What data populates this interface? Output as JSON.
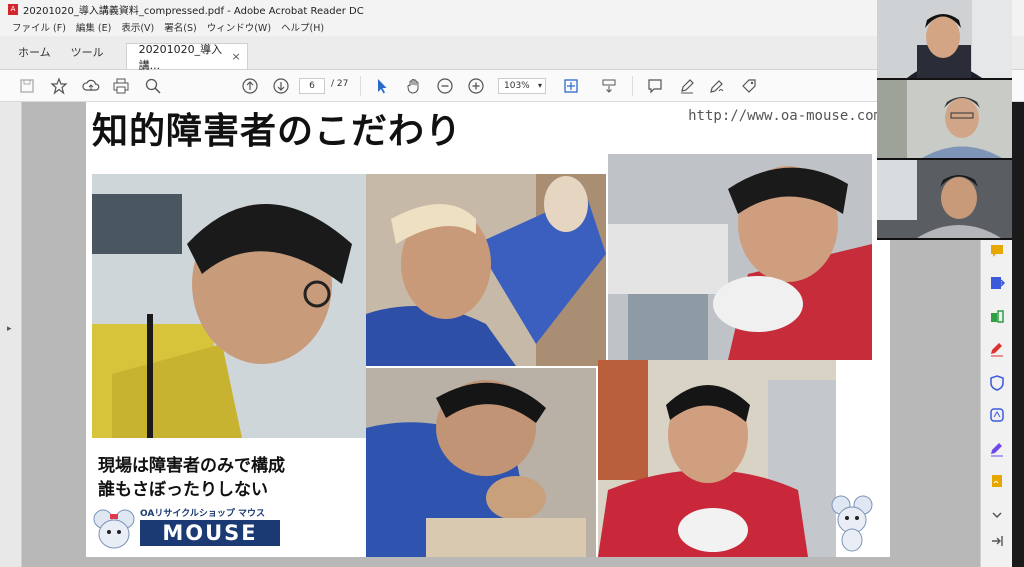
{
  "window": {
    "title": "20201020_導入講義資料_compressed.pdf - Adobe Acrobat Reader DC"
  },
  "menu": [
    "ファイル (F)",
    "編集 (E)",
    "表示(V)",
    "署名(S)",
    "ウィンドウ(W)",
    "ヘルプ(H)"
  ],
  "tabs": {
    "home": "ホーム",
    "tools": "ツール",
    "document": "20201020_導入講...",
    "close": "×"
  },
  "toolbar": {
    "page_current": "6",
    "page_total": "/ 27",
    "zoom": "103%",
    "zoom_caret": "▾"
  },
  "slide": {
    "title": "知的障害者のこだわり",
    "url": "http://www.oa-mouse.com",
    "caption_line1": "現場は障害者のみで構成",
    "caption_line2": "誰もさぼったりしない",
    "logo_sub": "OAリサイクルショップ マウス",
    "logo_main": "MOUSE"
  },
  "colors": {
    "accent": "#1b3a73",
    "acrobat_red": "#d4262a",
    "right_panel_icons": [
      "#e6a700",
      "#3b5bdb",
      "#2f9e44",
      "#e03131",
      "#3b5bdb",
      "#3b5bdb",
      "#7048e8",
      "#e6a700"
    ]
  }
}
